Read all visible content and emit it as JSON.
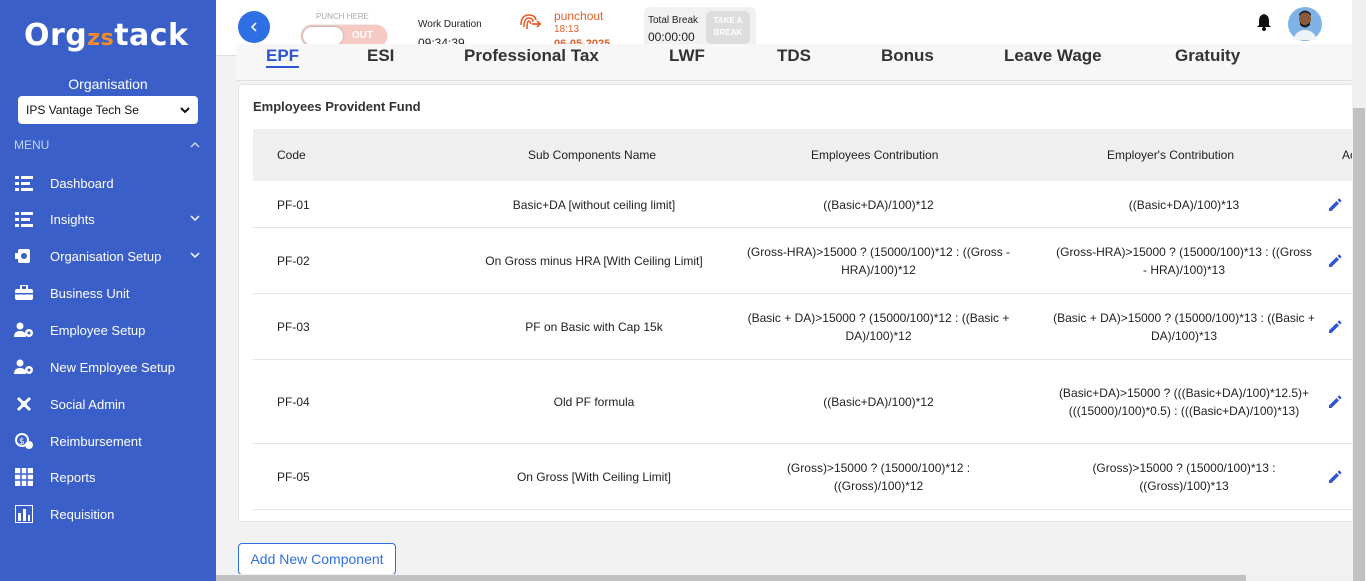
{
  "app": {
    "logo_text": "Orgzstack"
  },
  "sidebar": {
    "org_label": "Organisation",
    "org_selected": "IPS Vantage Tech Se",
    "menu_label": "MENU",
    "items": [
      {
        "label": "Dashboard",
        "icon": "dashboard-icon",
        "has_chevron": false
      },
      {
        "label": "Insights",
        "icon": "insights-icon",
        "has_chevron": true
      },
      {
        "label": "Organisation Setup",
        "icon": "org-setup-icon",
        "has_chevron": true
      },
      {
        "label": "Business Unit",
        "icon": "briefcase-icon",
        "has_chevron": false
      },
      {
        "label": "Employee Setup",
        "icon": "employee-icon",
        "has_chevron": false
      },
      {
        "label": "New Employee Setup",
        "icon": "new-employee-icon",
        "has_chevron": false
      },
      {
        "label": "Social Admin",
        "icon": "social-admin-icon",
        "has_chevron": false
      },
      {
        "label": "Reimbursement",
        "icon": "reimbursement-icon",
        "has_chevron": false
      },
      {
        "label": "Reports",
        "icon": "reports-icon",
        "has_chevron": false
      },
      {
        "label": "Requisition",
        "icon": "requisition-icon",
        "has_chevron": false
      }
    ]
  },
  "topbar": {
    "punch_here_label": "PUNCH HERE",
    "punch_state": "OUT",
    "work_duration_label": "Work Duration",
    "work_duration_value": "09:34:39",
    "punchout_label": "punchout",
    "punchout_time": "18:13",
    "punchout_date": "06-05-2025",
    "total_break_label": "Total Break",
    "total_break_value": "00:00:00",
    "take_break_label": "TAKE A BREAK"
  },
  "tabs": [
    "EPF",
    "ESI",
    "Professional Tax",
    "LWF",
    "TDS",
    "Bonus",
    "Leave Wage",
    "Gratuity"
  ],
  "card": {
    "title": "Employees Provident Fund",
    "headers": [
      "Code",
      "Sub Components Name",
      "Employees Contribution",
      "Employer's Contribution",
      "Ac"
    ],
    "rows": [
      {
        "code": "PF-01",
        "name": "Basic+DA [without ceiling limit]",
        "employee": "((Basic+DA)/100)*12",
        "employer": "((Basic+DA)/100)*13"
      },
      {
        "code": "PF-02",
        "name": "On Gross minus HRA [With Ceiling Limit]",
        "employee": "(Gross-HRA)>15000 ? (15000/100)*12 : ((Gross - HRA)/100)*12",
        "employer": "(Gross-HRA)>15000 ? (15000/100)*13 : ((Gross - HRA)/100)*13"
      },
      {
        "code": "PF-03",
        "name": "PF on Basic with Cap 15k",
        "employee": "(Basic + DA)>15000 ? (15000/100)*12 : ((Basic + DA)/100)*12",
        "employer": "(Basic + DA)>15000 ? (15000/100)*13 : ((Basic + DA)/100)*13"
      },
      {
        "code": "PF-04",
        "name": "Old PF formula",
        "employee": "((Basic+DA)/100)*12",
        "employer": "(Basic+DA)>15000 ? (((Basic+DA)/100)*12.5)+ (((15000)/100)*0.5) : (((Basic+DA)/100)*13)"
      },
      {
        "code": "PF-05",
        "name": "On Gross [With Ceiling Limit]",
        "employee": "(Gross)>15000 ? (15000/100)*12 : ((Gross)/100)*12",
        "employer": "(Gross)>15000 ? (15000/100)*13 : ((Gross)/100)*13"
      }
    ]
  },
  "add_button_label": "Add New Component",
  "colors": {
    "sidebar": "#3a5fc8",
    "accent": "#2f6fe4",
    "punchout": "#e45f2a"
  }
}
